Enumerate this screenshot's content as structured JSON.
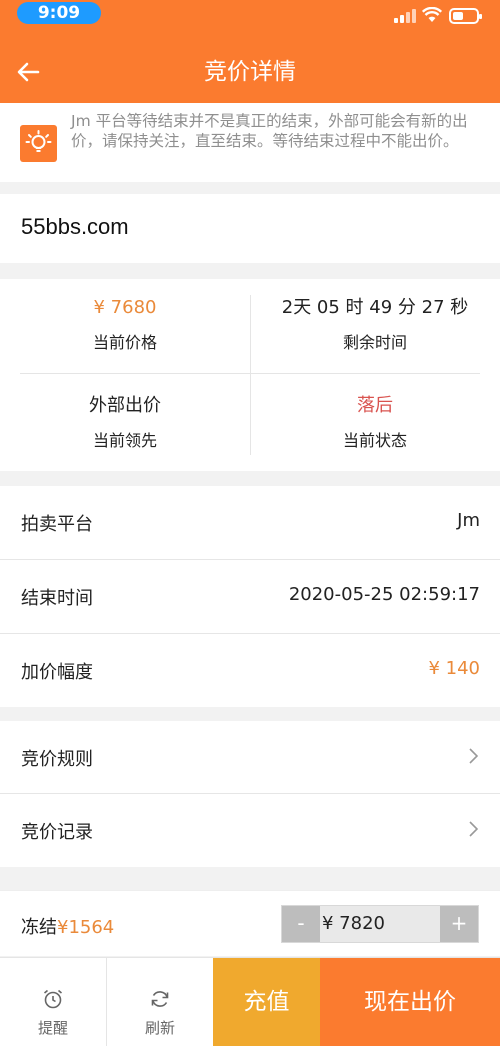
{
  "status_bar": {
    "time": "9:09"
  },
  "header": {
    "title": "竞价详情"
  },
  "notice": {
    "text": "Jm 平台等待结束并不是真正的结束，外部可能会有新的出价，请保持关注，直至结束。等待结束过程中不能出价。"
  },
  "domain": {
    "name": "55bbs.com"
  },
  "stats": {
    "current_price": {
      "value": "¥ 7680",
      "label": "当前价格"
    },
    "remaining_time": {
      "value": "2天 05 时 49 分 27 秒",
      "label": "剩余时间"
    },
    "current_leader": {
      "value": "外部出价",
      "label": "当前领先"
    },
    "current_status": {
      "value": "落后",
      "label": "当前状态"
    }
  },
  "info": {
    "platform": {
      "label": "拍卖平台",
      "value": "Jm"
    },
    "end_time": {
      "label": "结束时间",
      "value": "2020-05-25 02:59:17"
    },
    "increment": {
      "label": "加价幅度",
      "value": "¥ 140"
    }
  },
  "nav": {
    "rules": "竞价规则",
    "records": "竞价记录"
  },
  "bid": {
    "freeze_label": "冻结",
    "freeze_amount": "¥1564",
    "minus": "-",
    "plus": "+",
    "amount": "¥ 7820"
  },
  "bottom": {
    "remind": "提醒",
    "refresh": "刷新",
    "recharge": "充值",
    "bid_now": "现在出价"
  },
  "colors": {
    "brand": "#fb7b2f",
    "recharge": "#f0a92e",
    "price": "#ea8a3a",
    "status_behind": "#d9534f"
  }
}
